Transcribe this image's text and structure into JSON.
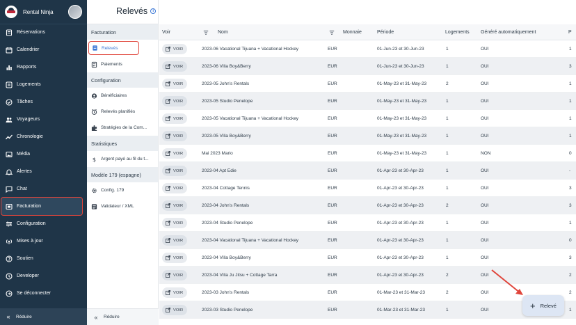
{
  "brand": {
    "name": "Rental Ninja"
  },
  "nav": {
    "items": [
      {
        "label": "Réservations",
        "icon": "reservations-icon"
      },
      {
        "label": "Calendrier",
        "icon": "calendar-icon"
      },
      {
        "label": "Rapports",
        "icon": "reports-icon"
      },
      {
        "label": "Logements",
        "icon": "properties-icon"
      },
      {
        "label": "Tâches",
        "icon": "tasks-icon"
      },
      {
        "label": "Voyageurs",
        "icon": "guests-icon"
      },
      {
        "label": "Chronologie",
        "icon": "timeline-icon"
      },
      {
        "label": "Média",
        "icon": "media-icon"
      },
      {
        "label": "Alertes",
        "icon": "alerts-icon"
      },
      {
        "label": "Chat",
        "icon": "chat-icon"
      },
      {
        "label": "Facturation",
        "icon": "billing-icon"
      },
      {
        "label": "Configuration",
        "icon": "settings-icon"
      },
      {
        "label": "Mises à jour",
        "icon": "updates-icon"
      },
      {
        "label": "Soutien",
        "icon": "support-icon"
      },
      {
        "label": "Developer",
        "icon": "developer-icon"
      },
      {
        "label": "Se déconnecter",
        "icon": "logout-icon"
      }
    ],
    "active": "Facturation",
    "reduire": "Réduire"
  },
  "subnav": {
    "sections": [
      {
        "title": "Facturation",
        "items": [
          {
            "label": "Relevés",
            "icon": "statements-icon"
          },
          {
            "label": "Paiements",
            "icon": "payments-icon"
          }
        ]
      },
      {
        "title": "Configuration",
        "items": [
          {
            "label": "Bénéficiaires",
            "icon": "beneficiaries-icon"
          },
          {
            "label": "Relevés planifiés",
            "icon": "scheduled-icon"
          },
          {
            "label": "Stratégies de la Com...",
            "icon": "strategy-icon"
          }
        ]
      },
      {
        "title": "Statistiques",
        "items": [
          {
            "label": "Argent payé au fil du t...",
            "icon": "dollar-icon"
          }
        ]
      },
      {
        "title": "Modèle 179 (espagne)",
        "items": [
          {
            "label": "Config. 179",
            "icon": "gear-icon"
          },
          {
            "label": "Validateur / XML",
            "icon": "validator-icon"
          }
        ]
      }
    ],
    "reduire": "Réduire"
  },
  "page": {
    "title": "Relevés"
  },
  "table": {
    "headers": {
      "voir": "Voir",
      "nom": "Nom",
      "monnaie": "Monnaie",
      "periode": "Période",
      "logements": "Logements",
      "auto": "Généré automatiquement",
      "p": "P"
    },
    "button_label": "VOIR",
    "rows": [
      {
        "nom": "2023-06 Vacational Tijuana + Vacational Hockey",
        "monnaie": "EUR",
        "periode": "01-Jun-23 et 30-Jun-23",
        "logements": "1",
        "auto": "OUI",
        "p": "1"
      },
      {
        "nom": "2023-06 Villa Boy&Berry",
        "monnaie": "EUR",
        "periode": "01-Jun-23 et 30-Jun-23",
        "logements": "1",
        "auto": "OUI",
        "p": "3"
      },
      {
        "nom": "2023-05 John's Rentals",
        "monnaie": "EUR",
        "periode": "01-May-23 et 31-May-23",
        "logements": "2",
        "auto": "OUI",
        "p": "1"
      },
      {
        "nom": "2023-05 Studio Penelope",
        "monnaie": "EUR",
        "periode": "01-May-23 et 31-May-23",
        "logements": "1",
        "auto": "OUI",
        "p": "1"
      },
      {
        "nom": "2023-05 Vacational Tijuana + Vacational Hockey",
        "monnaie": "EUR",
        "periode": "01-May-23 et 31-May-23",
        "logements": "1",
        "auto": "OUI",
        "p": "1"
      },
      {
        "nom": "2023-05 Villa Boy&Berry",
        "monnaie": "EUR",
        "periode": "01-May-23 et 31-May-23",
        "logements": "1",
        "auto": "OUI",
        "p": "1"
      },
      {
        "nom": "Mai 2023 Mario",
        "monnaie": "EUR",
        "periode": "01-May-23 et 31-May-23",
        "logements": "1",
        "auto": "NON",
        "p": "0"
      },
      {
        "nom": "2023-04 Apt Edie",
        "monnaie": "EUR",
        "periode": "01-Apr-23 et 30-Apr-23",
        "logements": "1",
        "auto": "OUI",
        "p": "-"
      },
      {
        "nom": "2023-04 Cottage Tennis",
        "monnaie": "EUR",
        "periode": "01-Apr-23 et 30-Apr-23",
        "logements": "1",
        "auto": "OUI",
        "p": "3"
      },
      {
        "nom": "2023-04 John's Rentals",
        "monnaie": "EUR",
        "periode": "01-Apr-23 et 30-Apr-23",
        "logements": "2",
        "auto": "OUI",
        "p": "3"
      },
      {
        "nom": "2023-04 Studio Penelope",
        "monnaie": "EUR",
        "periode": "01-Apr-23 et 30-Apr-23",
        "logements": "1",
        "auto": "OUI",
        "p": "1"
      },
      {
        "nom": "2023-04 Vacational Tijuana + Vacational Hockey",
        "monnaie": "EUR",
        "periode": "01-Apr-23 et 30-Apr-23",
        "logements": "1",
        "auto": "OUI",
        "p": "0"
      },
      {
        "nom": "2023-04 Villa Boy&Berry",
        "monnaie": "EUR",
        "periode": "01-Apr-23 et 30-Apr-23",
        "logements": "1",
        "auto": "OUI",
        "p": "3"
      },
      {
        "nom": "2023-04 Villa Ju Jitsu + Cottage Tarra",
        "monnaie": "EUR",
        "periode": "01-Apr-23 et 30-Apr-23",
        "logements": "2",
        "auto": "OUI",
        "p": "2"
      },
      {
        "nom": "2023-03 John's Rentals",
        "monnaie": "EUR",
        "periode": "01-Mar-23 et 31-Mar-23",
        "logements": "2",
        "auto": "OUI",
        "p": "2"
      },
      {
        "nom": "2023-03 Studio Penelope",
        "monnaie": "EUR",
        "periode": "01-Mar-23 et 31-Mar-23",
        "logements": "1",
        "auto": "OUI",
        "p": "1"
      }
    ]
  },
  "fab": {
    "label": "Relevé"
  },
  "colors": {
    "sidebar": "#1f3548",
    "accent": "#3b78d6",
    "highlight": "#e0453b"
  }
}
